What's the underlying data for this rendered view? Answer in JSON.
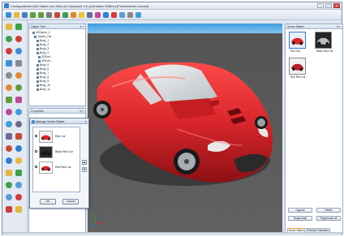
{
  "window": {
    "title": "Configurations with States.cmr  SimLab Composer 2.5 (Animation Edition) [Professional License]",
    "buttons": [
      "–",
      "□",
      "×"
    ]
  },
  "toolbar": {
    "icons": [
      "new-icon",
      "open-icon",
      "save-icon",
      "undo-icon",
      "redo-icon",
      "select-icon",
      "move-icon",
      "rotate-icon",
      "scale-icon",
      "light-icon",
      "camera-icon",
      "material-icon",
      "render-icon",
      "delete-icon",
      "snapshot-icon",
      "settings-icon",
      "help-icon"
    ],
    "icon_colors": [
      "#3b8fd9",
      "#e6b63a",
      "#4a7ec4",
      "#5c9d3c",
      "#5c9d3c",
      "#7a7a7a",
      "#c84a3a",
      "#3f9a55",
      "#e08a2a",
      "#f2c233",
      "#6b6b8f",
      "#c04a9a",
      "#2f7fd1",
      "#d33a3a",
      "#5a9bd5",
      "#8a8a8a",
      "#3fa0d9"
    ]
  },
  "object_tree": {
    "title": "Object Tree",
    "header_buttons": "▾ ×",
    "items": [
      "3DScene_1",
      "Sports_Car",
      "Body_1",
      "Body_2",
      "Body_3",
      "Body_4",
      "3DSurf...",
      "3DSurf...",
      "Body_5",
      "Body_6",
      "Body_7",
      "Body_8",
      "Body_9",
      "Body_10",
      "Body_11"
    ]
  },
  "properties": {
    "title": "Properties",
    "header_buttons": "▾ ×"
  },
  "dialog": {
    "title": "Manage Scene States",
    "close": "×",
    "states": [
      {
        "label": "Red Car",
        "bg": "#f0f0f0",
        "car": "#d8262b"
      },
      {
        "label": "Black Red Car",
        "bg": "#2a2a2a",
        "car": "#1a1a1a"
      },
      {
        "label": "Red Red Car",
        "bg": "#ffffff",
        "car": "#c8282c"
      }
    ],
    "ok": "OK",
    "cancel": "Cancel",
    "up": "▲",
    "down": "▼"
  },
  "scene_states": {
    "title": "Scene States",
    "header_buttons": "▾ ×",
    "items": [
      {
        "label": "Red Car",
        "bg": "#e8eef5",
        "car": "#d8262b",
        "selected": true
      },
      {
        "label": "Black Red Car",
        "bg": "#262626",
        "car": "#bdbdbd",
        "selected": false
      },
      {
        "label": "Red Red Car",
        "bg": "#f2f2f2",
        "car": "#b81f24",
        "selected": false
      }
    ],
    "buttons": {
      "capture": "Capture",
      "delete": "Delete",
      "regenerate": "Regenerate",
      "regenerate_all": "Regenerate All"
    },
    "tabs": [
      "Scene States",
      "Preview Transform"
    ]
  },
  "colors": {
    "car_red": "#d8262b",
    "sky_top": "#4ea9e6",
    "ground": "#5a5a5a"
  }
}
